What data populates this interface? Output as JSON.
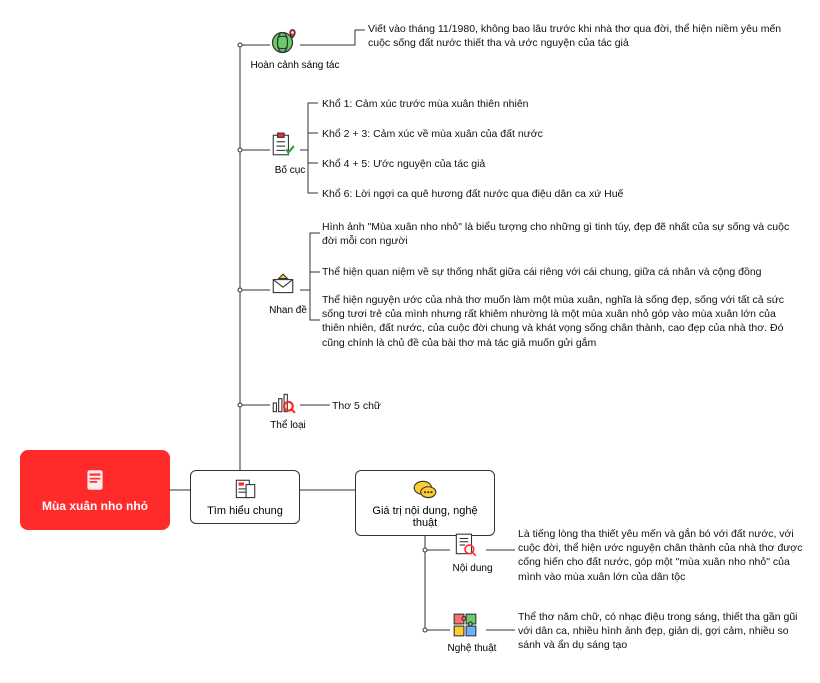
{
  "root": {
    "title": "Mùa xuân nho nhỏ"
  },
  "branch1": {
    "title": "Tìm hiểu chung"
  },
  "branch2": {
    "title": "Giá trị nội dung, nghệ thuật"
  },
  "tim_hieu": {
    "hoan_canh": {
      "label": "Hoàn cảnh sáng tác",
      "text": "Viết vào tháng 11/1980, không bao lâu trước khi nhà thơ qua đời, thể hiện niềm yêu mến cuộc sống đất nước thiết tha và ước nguyện của tác giả"
    },
    "bo_cuc": {
      "label": "Bố cục",
      "k1": "Khổ 1: Cảm xúc trước mùa xuân thiên nhiên",
      "k2": "Khổ 2 + 3: Cảm xúc về mùa xuân của đất nước",
      "k3": "Khổ 4 + 5: Ước nguyện của tác giả",
      "k4": "Khổ 6: Lời ngợi ca quê hương đất nước qua điệu dân ca xứ Huế"
    },
    "nhan_de": {
      "label": "Nhan đề",
      "t1": "Hình ảnh \"Mùa xuân nho nhỏ\" là biểu tượng cho những gì tinh túy, đẹp đẽ nhất của sự sống và cuộc đời mỗi con người",
      "t2": "Thể hiện quan niệm về sự thống nhất giữa cái riêng với cái chung, giữa cá nhân và cộng đồng",
      "t3": "Thể hiện nguyện ước của nhà thơ muốn làm một mùa xuân, nghĩa là sống đẹp, sống với tất cả sức sống tươi trẻ của mình nhưng rất khiêm nhường là một mùa xuân nhỏ góp vào mùa xuân lớn của thiên nhiên, đất nước, của cuộc đời chung và khát vọng sống chân thành, cao đẹp của nhà thơ. Đó cũng chính là chủ đề của bài thơ mà tác giả muốn gửi gắm"
    },
    "the_loai": {
      "label": "Thể loại",
      "text": "Thơ 5 chữ"
    }
  },
  "gia_tri": {
    "noi_dung": {
      "label": "Nội dung",
      "text": "Là tiếng lòng tha thiết yêu mến và gắn bó với đất nước, với cuộc đời, thể hiện ước nguyện chân thành của nhà thơ được cống hiến cho đất nước, góp một \"mùa xuân nho nhỏ\" của mình vào mùa xuân lớn của dân tộc"
    },
    "nghe_thuat": {
      "label": "Nghệ thuật",
      "text": "Thể thơ năm chữ, có nhạc điệu trong sáng, thiết tha gần gũi với dân ca, nhiều hình ảnh đẹp, giản dị, gợi cảm, nhiều so sánh và ẩn dụ sáng tạo"
    }
  }
}
